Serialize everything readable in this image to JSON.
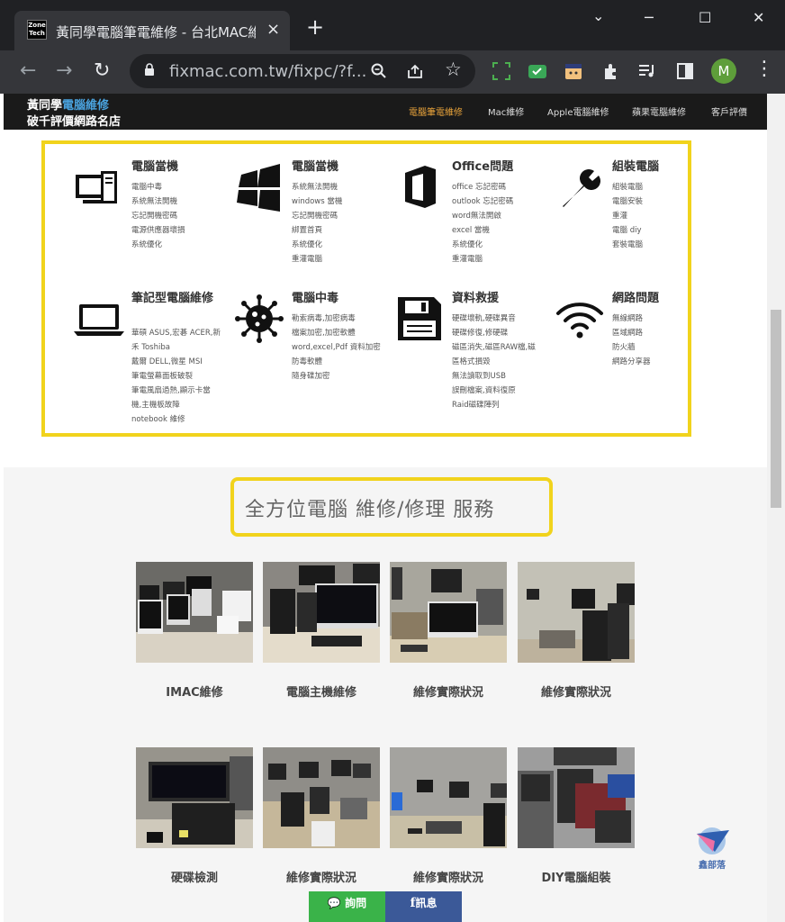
{
  "browser": {
    "tab_title": "黃同學電腦筆電維修 - 台北MAC維",
    "tab_favicon_text": "Zone Tech",
    "url": "fixmac.com.tw/fixpc/?f...",
    "profile_initial": "M",
    "new_tab_label": "+",
    "close_tab_label": "×",
    "window_controls": {
      "minimize": "─",
      "maximize": "☐",
      "close": "✕",
      "tab_list": "⌄"
    }
  },
  "site": {
    "brand_line1_prefix": "黃同學",
    "brand_line1_highlight": "電腦維修",
    "brand_line2": "破千評價網路名店",
    "nav": [
      "電腦筆電維修",
      "Mac維修",
      "Apple電腦維修",
      "蘋果電腦維修",
      "客戶評價"
    ],
    "accent_color": "#f1d31c"
  },
  "services": [
    {
      "title": "電腦當機",
      "icon": "desktop-computer-icon",
      "lines": [
        "電腦中毒",
        "系統無法開機",
        "忘記開機密碼",
        "電源供應器壞損",
        "系統優化"
      ]
    },
    {
      "title": "電腦當機",
      "icon": "windows-logo-icon",
      "lines": [
        "系統無法開機",
        "windows 當機",
        "忘記開機密碼",
        "綁置首頁",
        "系統優化",
        "重灌電腦"
      ]
    },
    {
      "title": "Office問題",
      "icon": "office-logo-icon",
      "lines": [
        "office 忘記密碼",
        "outlook 忘記密碼",
        "word無法開啟",
        "excel 當機",
        "系統優化",
        "重灌電腦"
      ]
    },
    {
      "title": "組裝電腦",
      "icon": "wrench-icon",
      "lines": [
        "組裝電腦",
        "電腦安裝",
        "重灌",
        "電腦 diy",
        "套裝電腦"
      ]
    },
    {
      "title": "筆記型電腦維修",
      "icon": "laptop-icon",
      "lines": [
        "華碩 ASUS,宏碁 ACER,新",
        "禾 Toshiba",
        "戴爾 DELL,微星 MSI",
        "筆電螢幕面板破裂",
        "筆電風扇過熱,顯示卡當",
        "機,主機板故障",
        "notebook 維修"
      ]
    },
    {
      "title": "電腦中毒",
      "icon": "virus-icon",
      "lines": [
        "勒索病毒,加密病毒",
        "檔案加密,加密軟體",
        "word,excel,Pdf 資料加密",
        "防毒軟體",
        "隨身碟加密"
      ]
    },
    {
      "title": "資料救援",
      "icon": "floppy-disk-icon",
      "lines": [
        "硬碟壞軌,硬碟異音",
        "硬碟修復,修硬碟",
        "磁區消失,磁區RAW檔,磁",
        "區格式損毀",
        "無法讀取到USB",
        "誤刪檔案,資料復原",
        "Raid磁碟陣列"
      ]
    },
    {
      "title": "網路問題",
      "icon": "wifi-icon",
      "lines": [
        "無線網路",
        "區域網路",
        "防火牆",
        "網路分享器"
      ]
    }
  ],
  "section_heading": "全方位電腦 維修/修理 服務",
  "gallery": [
    {
      "caption": "IMAC維修"
    },
    {
      "caption": "電腦主機維修"
    },
    {
      "caption": "維修實際狀況"
    },
    {
      "caption": "維修實際狀況"
    },
    {
      "caption": "硬碟檢測"
    },
    {
      "caption": "維修實際狀況"
    },
    {
      "caption": "維修實際狀況"
    },
    {
      "caption": "DIY電腦組裝"
    }
  ],
  "contact": {
    "line_label": "詢問",
    "fb_label": "訊息"
  },
  "watermark_text": "鑫部落"
}
